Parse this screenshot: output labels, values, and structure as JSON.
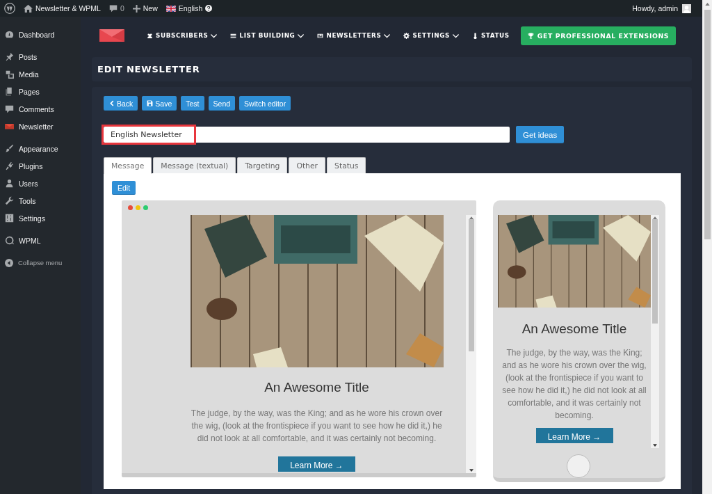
{
  "admin_bar": {
    "site": "Newsletter & WPML",
    "comments": "0",
    "new": "New",
    "language": "English",
    "greeting": "Howdy, admin"
  },
  "sidebar": {
    "groups": [
      [
        {
          "label": "Dashboard",
          "selected": false
        }
      ],
      [
        {
          "label": "Posts",
          "selected": false
        },
        {
          "label": "Media",
          "selected": false
        },
        {
          "label": "Pages",
          "selected": false
        },
        {
          "label": "Comments",
          "selected": false
        },
        {
          "label": "Newsletter",
          "selected": false
        }
      ],
      [
        {
          "label": "Appearance",
          "selected": false
        },
        {
          "label": "Plugins",
          "selected": false
        },
        {
          "label": "Users",
          "selected": false
        },
        {
          "label": "Tools",
          "selected": false
        },
        {
          "label": "Settings",
          "selected": false
        }
      ],
      [
        {
          "label": "WPML",
          "selected": false
        }
      ]
    ],
    "collapse": "Collapse menu"
  },
  "plugin_nav": {
    "items": [
      {
        "label": "SUBSCRIBERS",
        "dropdown": true
      },
      {
        "label": "LIST BUILDING",
        "dropdown": true
      },
      {
        "label": "NEWSLETTERS",
        "dropdown": true
      },
      {
        "label": "SETTINGS",
        "dropdown": true
      },
      {
        "label": "STATUS",
        "dropdown": false
      }
    ],
    "cta": "GET PROFESSIONAL EXTENSIONS"
  },
  "page_title": "EDIT NEWSLETTER",
  "toolbar": [
    "Back",
    "Save",
    "Test",
    "Send",
    "Switch editor"
  ],
  "subject": {
    "value": "English Newsletter",
    "highlighted": true
  },
  "get_ideas": "Get ideas",
  "tabs": [
    {
      "label": "Message",
      "selected": true
    },
    {
      "label": "Message (textual)",
      "selected": false
    },
    {
      "label": "Targeting",
      "selected": false
    },
    {
      "label": "Other",
      "selected": false
    },
    {
      "label": "Status",
      "selected": false
    }
  ],
  "edit_button": "Edit",
  "desktop_preview": {
    "title": "An Awesome Title",
    "body": "The judge, by the way, was the King; and as he wore his crown over the wig, (look at the frontispiece if you want to see how he did it,) he did not look at all comfortable, and it was certainly not becoming.",
    "button": "Learn More →"
  },
  "mobile_preview": {
    "title": "An Awesome Title",
    "body": "The judge, by the way, was the King; and as he wore his crown over the wig, (look at the frontispiece if you want to see how he did it,) he did not look at all comfortable, and it was certainly not becoming.",
    "button": "Learn More →"
  }
}
